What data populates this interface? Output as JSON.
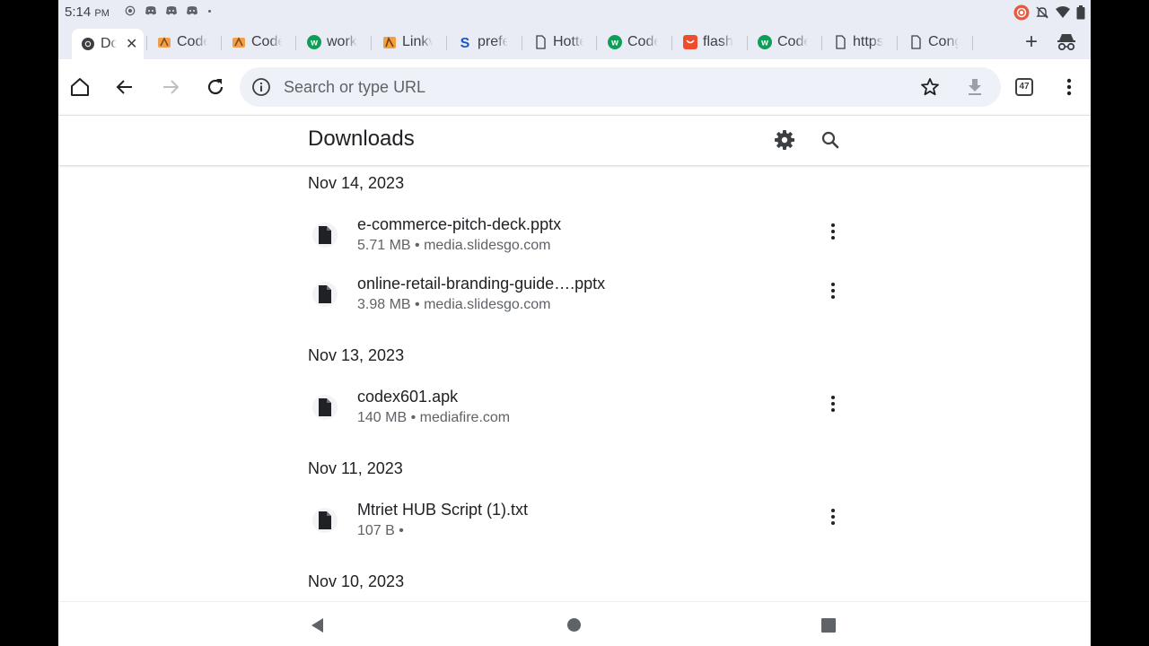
{
  "status_bar": {
    "time": "5:14",
    "ampm": "PM",
    "left_icons": [
      "record-icon",
      "discord-icon",
      "discord-icon",
      "discord-icon",
      "dot-icon"
    ],
    "right_icons": [
      "screen-record-icon",
      "mute-icon",
      "wifi-icon",
      "battery-icon"
    ]
  },
  "tabs": [
    {
      "label": "Downloads",
      "favicon": "chrome-icon",
      "active": true
    },
    {
      "label": "CodeX",
      "favicon": "codex-icon"
    },
    {
      "label": "CodeX",
      "favicon": "codex-icon"
    },
    {
      "label": "work",
      "favicon": "w-green-icon"
    },
    {
      "label": "Linkvertise",
      "favicon": "linkvertise-icon"
    },
    {
      "label": "prefer",
      "favicon": "s-blue-icon"
    },
    {
      "label": "Hotte",
      "favicon": "page-icon"
    },
    {
      "label": "CodeX",
      "favicon": "w-green-icon"
    },
    {
      "label": "flash",
      "favicon": "orange-icon"
    },
    {
      "label": "CodeX",
      "favicon": "w-green-icon"
    },
    {
      "label": "https",
      "favicon": "page-icon"
    },
    {
      "label": "Congr",
      "favicon": "page-icon"
    }
  ],
  "toolbar": {
    "omnibox_placeholder": "Search or type URL",
    "tab_count": "47"
  },
  "downloads": {
    "title": "Downloads",
    "groups": [
      {
        "date": "Nov 14, 2023",
        "items": [
          {
            "name": "e-commerce-pitch-deck.pptx",
            "meta": "5.71 MB • media.slidesgo.com"
          },
          {
            "name": "online-retail-branding-guide….pptx",
            "meta": "3.98 MB • media.slidesgo.com"
          }
        ]
      },
      {
        "date": "Nov 13, 2023",
        "items": [
          {
            "name": "codex601.apk",
            "meta": "140 MB • mediafire.com"
          }
        ]
      },
      {
        "date": "Nov 11, 2023",
        "items": [
          {
            "name": "Mtriet HUB Script (1).txt",
            "meta": "107 B •"
          }
        ]
      },
      {
        "date": "Nov 10, 2023",
        "items": []
      }
    ]
  },
  "colors": {
    "chrome_bg": "#e9ecf5",
    "omnibox_bg": "#eef1f8",
    "text_primary": "#202124",
    "text_secondary": "#5f6368"
  }
}
